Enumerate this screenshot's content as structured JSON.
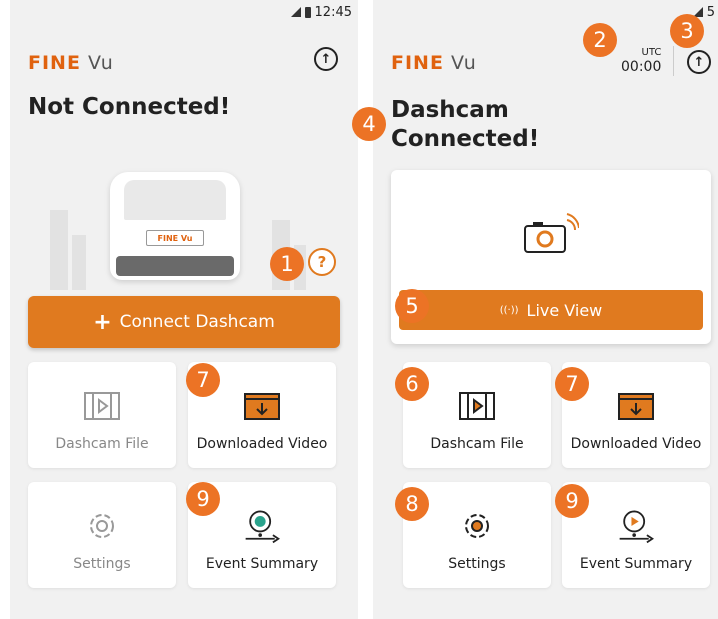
{
  "left_screen": {
    "status": {
      "time": "12:45"
    },
    "logo": {
      "fine": "FINE",
      "vu": "Vu"
    },
    "title": "Not Connected!",
    "car_plate": "FINE Vu",
    "help": "?",
    "connect_button": {
      "plus": "+",
      "label": "Connect Dashcam"
    },
    "tiles": [
      {
        "label": "Dashcam File",
        "icon": "film-icon"
      },
      {
        "label": "Downloaded Video",
        "icon": "folder-download-icon"
      },
      {
        "label": "Settings",
        "icon": "gear-icon"
      },
      {
        "label": "Event Summary",
        "icon": "map-pin-route-icon"
      }
    ]
  },
  "right_screen": {
    "status": {
      "time": "5"
    },
    "logo": {
      "fine": "FINE",
      "vu": "Vu"
    },
    "utc_label": "UTC",
    "utc_time": "00:00",
    "title_line1": "Dashcam",
    "title_line2": "Connected!",
    "live_view": {
      "wave": "((·))",
      "label": "Live View"
    },
    "tiles": [
      {
        "label": "Dashcam File",
        "icon": "film-icon"
      },
      {
        "label": "Downloaded Video",
        "icon": "folder-download-icon"
      },
      {
        "label": "Settings",
        "icon": "gear-icon"
      },
      {
        "label": "Event Summary",
        "icon": "map-pin-route-icon"
      }
    ]
  },
  "badges": [
    "1",
    "2",
    "3",
    "4",
    "5",
    "6",
    "7",
    "7",
    "8",
    "9",
    "9"
  ],
  "colors": {
    "accent": "#e07a1f",
    "badge": "#ec7325",
    "background": "#f1f1f1"
  }
}
